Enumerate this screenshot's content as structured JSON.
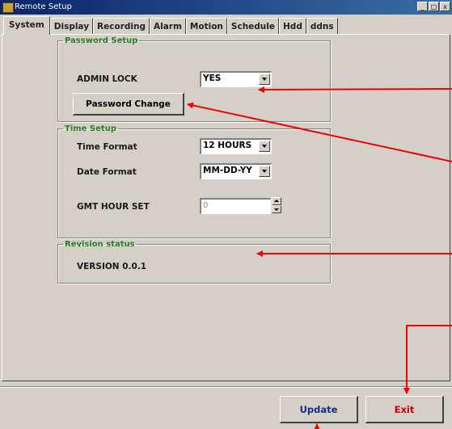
{
  "window": {
    "title": "Remote Setup",
    "controls": {
      "minimize": "_",
      "maximize": "□",
      "close": "x"
    }
  },
  "tabs": [
    {
      "label": "System",
      "active": true
    },
    {
      "label": "Display"
    },
    {
      "label": "Recording"
    },
    {
      "label": "Alarm"
    },
    {
      "label": "Motion"
    },
    {
      "label": "Schedule"
    },
    {
      "label": "Hdd"
    },
    {
      "label": "ddns"
    }
  ],
  "password_setup": {
    "legend": "Password Setup",
    "admin_lock_label": "ADMIN LOCK",
    "admin_lock_value": "YES",
    "password_change_button": "Password Change"
  },
  "time_setup": {
    "legend": "Time Setup",
    "time_format_label": "Time Format",
    "time_format_value": "12 HOURS",
    "date_format_label": "Date Format",
    "date_format_value": "MM-DD-YY",
    "gmt_label": "GMT HOUR SET",
    "gmt_value": "0"
  },
  "revision": {
    "legend": "Revision status",
    "version": "VERSION 0.0.1"
  },
  "footer": {
    "update_button": "Update",
    "exit_button": "Exit"
  },
  "colors": {
    "legend_green": "#2a7a2a",
    "update_blue": "#1a2a8a",
    "exit_red": "#cc0000",
    "annotation_red": "#ee0000"
  }
}
